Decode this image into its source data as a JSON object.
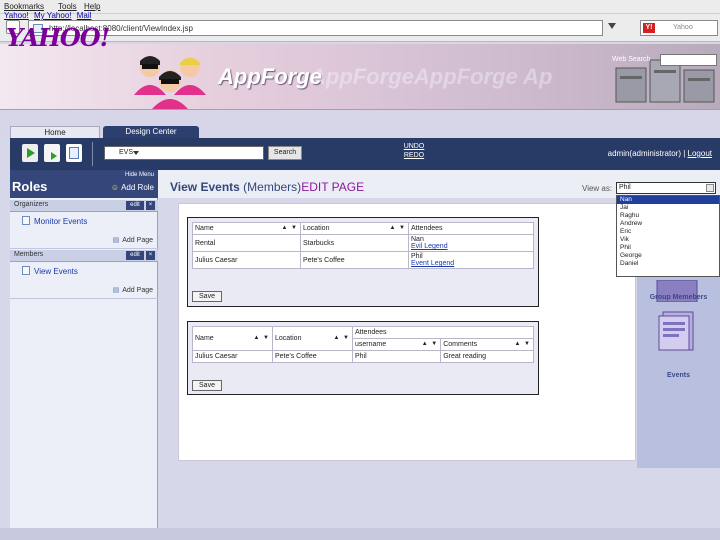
{
  "browser": {
    "menu": [
      "Bookmarks",
      "Tools",
      "Help"
    ],
    "url": "http://localhost:8080/client/ViewIndex.jsp",
    "search_placeholder": "Yahoo",
    "search_badge": "Y!"
  },
  "banner": {
    "yahoo_links": [
      "Yahoo!",
      "My Yahoo!",
      "Mail"
    ],
    "yahoo_logo": "YAHOO!",
    "brand": "AppForge",
    "brand_ghost": "AppForgeAppForge Ap",
    "web_search_label": "Web Search"
  },
  "tabs": {
    "home": "Home",
    "design": "Design Center"
  },
  "toolbar": {
    "select_value": "EVS",
    "search_button": "Search",
    "undo": "UNDO",
    "redo": "REDO",
    "user_text": "admin(administrator) |",
    "logout": "Logout"
  },
  "sidebar": {
    "hide_menu": "Hide Menu",
    "title": "Roles",
    "add_role": "Add Role",
    "groups": [
      {
        "label": "Organizers",
        "edit": "edit",
        "close": "×",
        "link": "Monitor Events",
        "add_page": "Add Page"
      },
      {
        "label": "Members",
        "edit": "edit",
        "close": "×",
        "link": "View Events",
        "add_page": "Add Page"
      }
    ]
  },
  "main": {
    "title": "View Events",
    "subtitle": "(Members)",
    "edit_page": "EDIT PAGE",
    "view_as_label": "View as:",
    "view_as_value": "Phil",
    "dropdown": [
      "Nan",
      "Jai",
      "Raghu",
      "Andrew",
      "Eric",
      "Vik",
      "Phil",
      "George",
      "Daniel"
    ],
    "dropdown_selected": "Nan"
  },
  "table1": {
    "headers": [
      "Name",
      "Location",
      "Attendees"
    ],
    "rows": [
      {
        "name": "Rental",
        "location": "Starbucks",
        "attendees": [
          "Nan",
          "Evil Legend"
        ]
      },
      {
        "name": "Julius Caesar",
        "location": "Pete's Coffee",
        "attendees": [
          "Phil",
          "Event Legend"
        ]
      }
    ],
    "sort_glyph": "▲ ▼",
    "save": "Save"
  },
  "table2": {
    "group_header": "Attendees",
    "headers": [
      "Name",
      "Location",
      "username",
      "Comments"
    ],
    "rows": [
      {
        "name": "Julius Caesar",
        "location": "Pete's Coffee",
        "username": "Phil",
        "comments": "Great reading"
      }
    ],
    "save": "Save"
  },
  "right_panel": {
    "items": [
      "Group Memebers",
      "Events"
    ]
  },
  "colors": {
    "navy": "#283a66",
    "accent": "#8a1a9a",
    "link": "#1a3aaa"
  }
}
